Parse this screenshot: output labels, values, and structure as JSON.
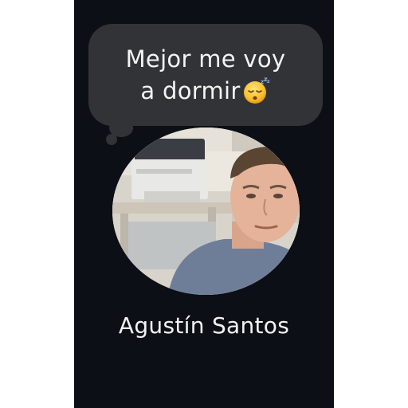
{
  "status_bubble": {
    "line1": "Mejor me voy",
    "line2": "a dormir",
    "emoji_icon": "sleeping-face-emoji"
  },
  "profile": {
    "name": "Agustín Santos",
    "avatar_icon": "profile-photo"
  },
  "colors": {
    "background": "#0d0f16",
    "bubble": "#323336",
    "text": "#f4f4f4"
  }
}
